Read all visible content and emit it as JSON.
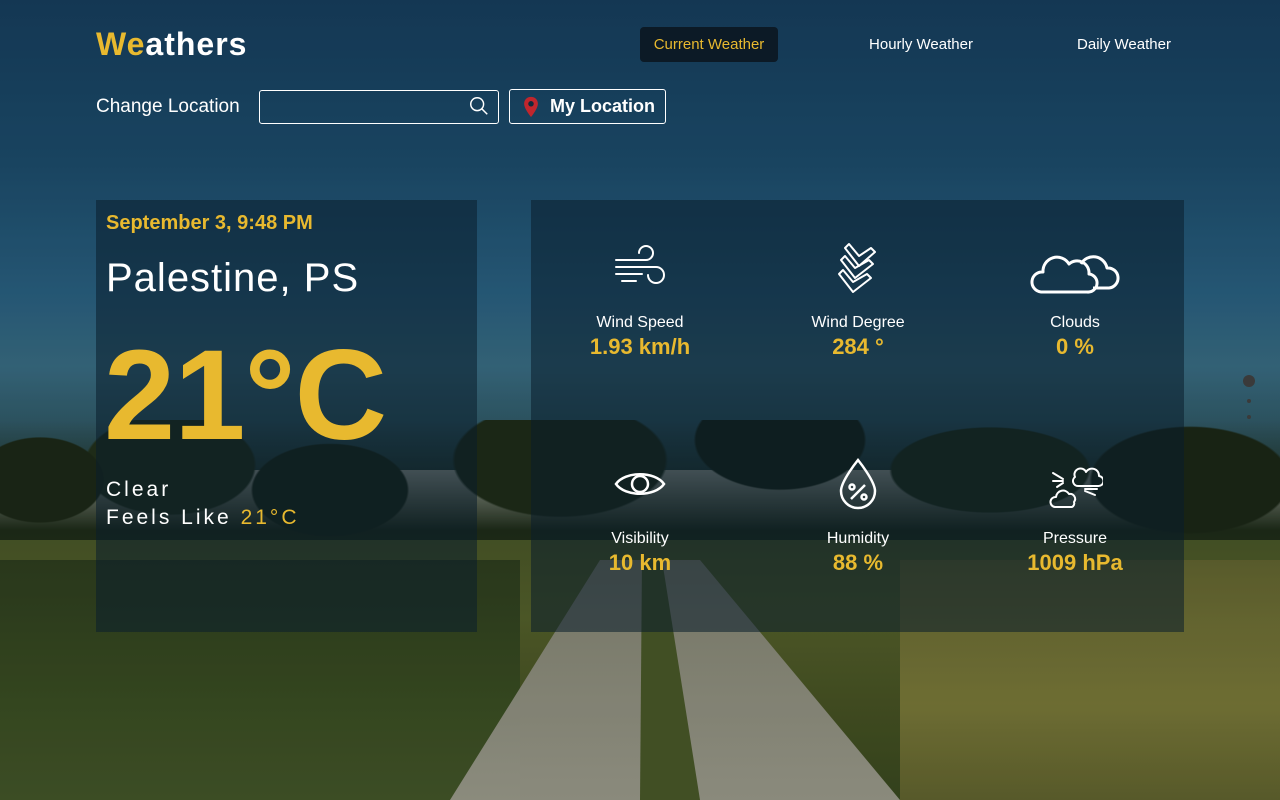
{
  "app": {
    "logo_accent": "We",
    "logo_rest": "athers"
  },
  "nav": {
    "current": "Current Weather",
    "hourly": "Hourly Weather",
    "daily": "Daily Weather",
    "active": "Current Weather"
  },
  "location_bar": {
    "label": "Change Location",
    "input_value": "",
    "input_placeholder": "",
    "my_location_label": "My Location"
  },
  "current": {
    "datetime": "September 3, 9:48 PM",
    "city": "Palestine, PS",
    "temperature": "21°C",
    "condition": "Clear",
    "feels_like_label": "Feels Like",
    "feels_like_value": "21°C"
  },
  "metrics": [
    {
      "icon": "wind-icon",
      "label": "Wind Speed",
      "value": "1.93 km/h"
    },
    {
      "icon": "wind-direction-icon",
      "label": "Wind Degree",
      "value": "284 °"
    },
    {
      "icon": "clouds-icon",
      "label": "Clouds",
      "value": "0 %"
    },
    {
      "icon": "eye-icon",
      "label": "Visibility",
      "value": "10 km"
    },
    {
      "icon": "humidity-drop-icon",
      "label": "Humidity",
      "value": "88 %"
    },
    {
      "icon": "pressure-icon",
      "label": "Pressure",
      "value": "1009 hPa"
    }
  ],
  "colors": {
    "accent": "#e8b92f",
    "nav_active_bg": "#0c1a26",
    "pin": "#c0262d"
  }
}
